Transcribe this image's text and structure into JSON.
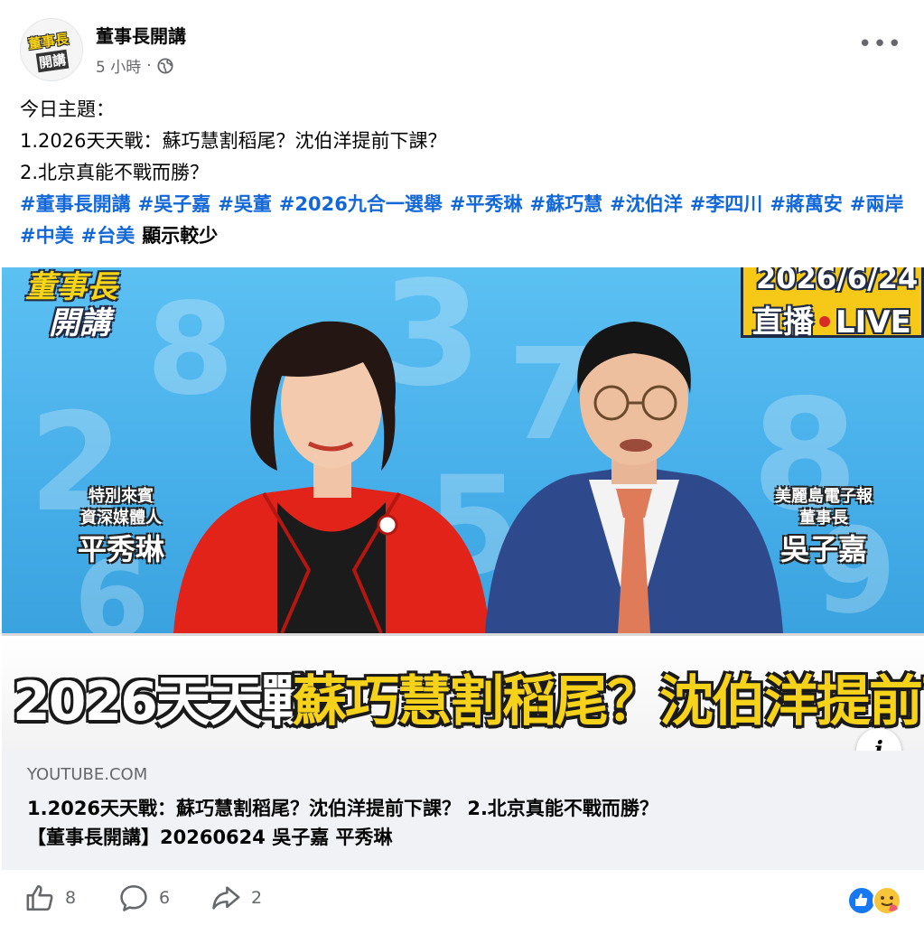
{
  "post": {
    "page_name": "董事長開講",
    "time": "5 小時",
    "separator": "·",
    "lines": [
      "今日主題：",
      "1.2026天天戰：蘇巧慧割稻尾？沈伯洋提前下課？",
      "2.北京真能不戰而勝？"
    ],
    "hashtags": [
      "#董事長開講",
      "#吳子嘉",
      "#吳董",
      "#2026九合一選舉",
      "#平秀琳",
      "#蘇巧慧",
      "#沈伯洋",
      "#李四川",
      "#蔣萬安",
      "#兩岸",
      "#中美",
      "#台美"
    ],
    "see_less": "顯示較少"
  },
  "thumbnail": {
    "show_logo_top": "董事長",
    "show_logo_bottom": "開講",
    "date": "2026/6/24",
    "live_cn": "直播",
    "live_en": "LIVE",
    "guest_left_role1": "特別來賓",
    "guest_left_role2": "資深媒體人",
    "guest_left_name": "平秀琳",
    "guest_right_role1": "美麗島電子報",
    "guest_right_role2": "董事長",
    "guest_right_name": "吳子嘉",
    "title_part1": "2026天天戰",
    "title_part2": "蘇巧慧割稻尾？沈伯洋提前下課？",
    "info_icon_label": "i"
  },
  "link": {
    "domain": "YOUTUBE.COM",
    "title_line1": "1.2026天天戰：蘇巧慧割稻尾？沈伯洋提前下課？ 2.北京真能不戰而勝？",
    "title_line2": "【董事長開講】20260624 吳子嘉 平秀琳"
  },
  "actions": {
    "likes": "8",
    "comments": "6",
    "shares": "2"
  },
  "colors": {
    "link_blue": "#1368d8",
    "meta_gray": "#65676b",
    "preview_bg": "#f0f2f5",
    "title_yellow": "#f6d21b",
    "like_blue": "#1877f2"
  }
}
